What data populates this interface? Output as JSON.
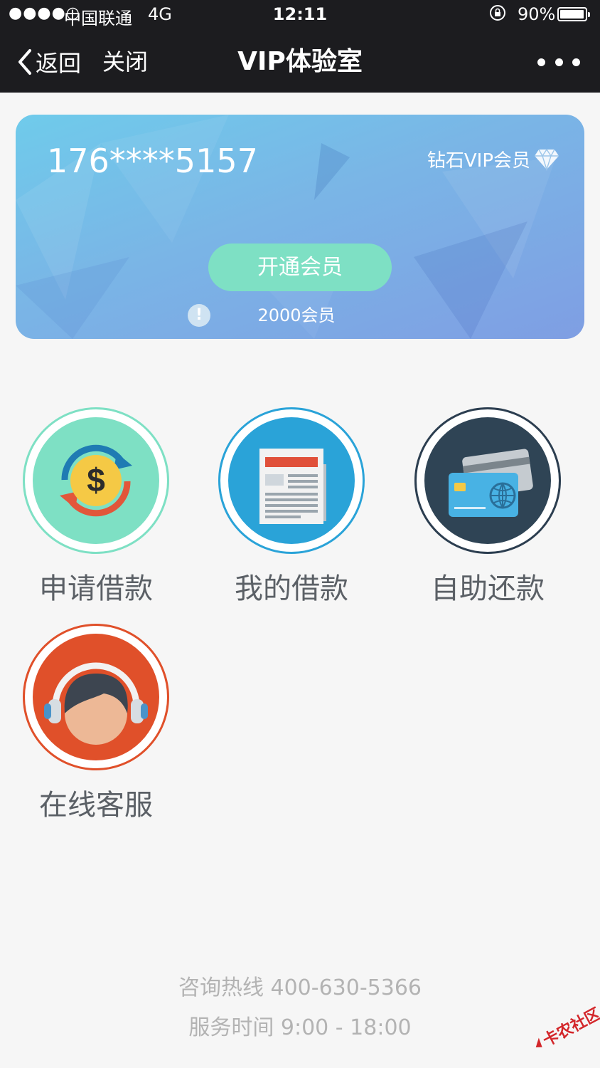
{
  "status_bar": {
    "signal": "●●●●○",
    "carrier": "中国联通",
    "network": "4G",
    "time": "12:11",
    "battery": "90%"
  },
  "nav": {
    "back_label": "返回",
    "close_label": "关闭",
    "title": "VIP体验室"
  },
  "vip_card": {
    "phone": "176****5157",
    "level": "钻石VIP会员",
    "open_button": "开通会员",
    "members": "2000会员"
  },
  "functions": [
    {
      "label": "申请借款",
      "icon": "money-exchange-icon"
    },
    {
      "label": "我的借款",
      "icon": "newspaper-icon"
    },
    {
      "label": "自助还款",
      "icon": "bank-card-icon"
    },
    {
      "label": "在线客服",
      "icon": "customer-service-icon"
    }
  ],
  "footer": {
    "hotline": "咨询热线 400-630-5366",
    "hours": "服务时间 9:00 - 18:00"
  },
  "watermark": "卡农社区",
  "colors": {
    "nav_bg": "#1c1c1f",
    "card_gradient": [
      "#6fcbeb",
      "#7f9ee3"
    ],
    "open_button": "#7ee0c4",
    "apply_loan": "#7ee0c4",
    "my_loans": "#2aa3d8",
    "repay": "#2c3e50",
    "service": "#e0502a"
  }
}
